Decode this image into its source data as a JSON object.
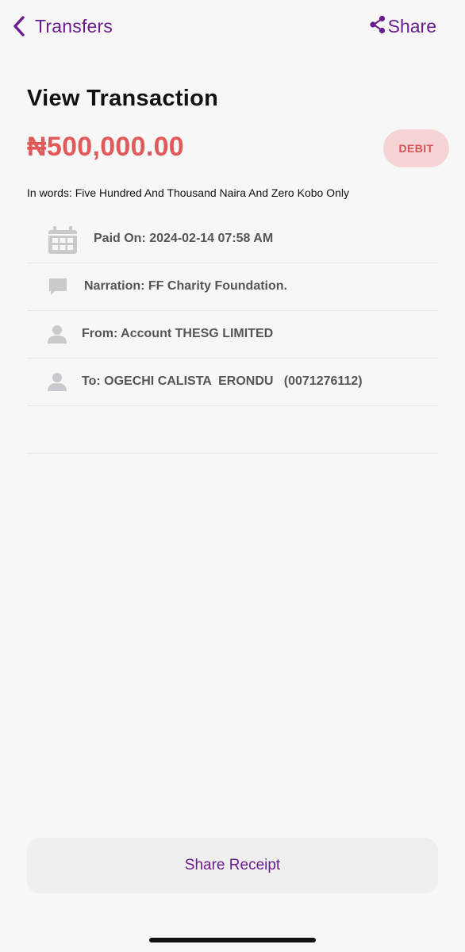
{
  "header": {
    "back_label": "Transfers",
    "share_label": "Share"
  },
  "transaction": {
    "title": "View Transaction",
    "amount": "₦500,000.00",
    "type_badge": "DEBIT",
    "in_words": "In words: Five Hundred And Thousand Naira And Zero Kobo Only"
  },
  "details": [
    {
      "icon": "calendar-icon",
      "text": "Paid On: 2024-02-14 07:58 AM"
    },
    {
      "icon": "chat-bubble-icon",
      "text": "Narration: FF Charity Foundation."
    },
    {
      "icon": "person-icon",
      "text": "From: Account THESG LIMITED"
    },
    {
      "icon": "person-icon",
      "text": "To: OGECHI CALISTA  ERONDU   (0071276112)"
    }
  ],
  "footer": {
    "share_receipt_label": "Share Receipt"
  },
  "colors": {
    "accent": "#6a1b8f",
    "debit_red": "#e05a5a",
    "badge_bg": "#f6d3d4",
    "icon_gray": "#c8cacd"
  }
}
